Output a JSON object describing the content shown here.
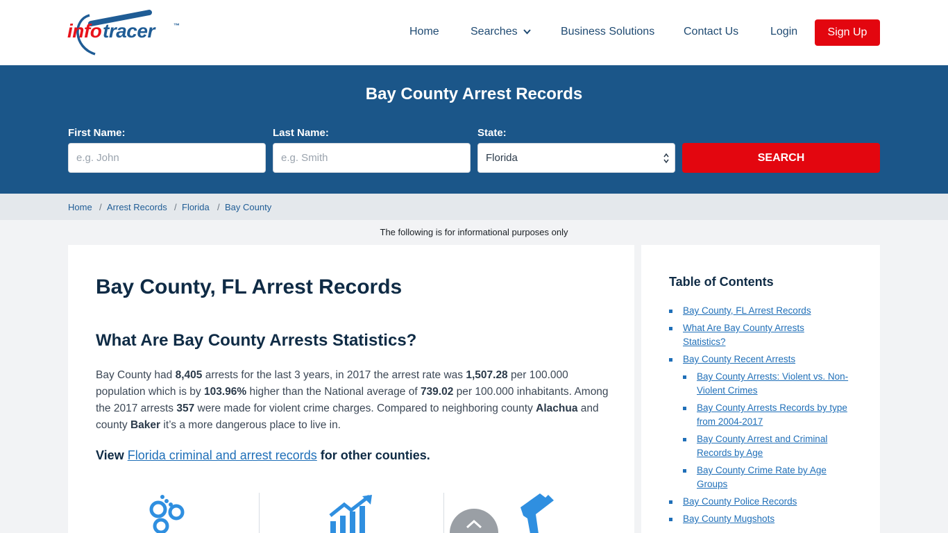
{
  "brand": {
    "part1": "info",
    "part2": "tracer",
    "tm": "™"
  },
  "nav": {
    "home": "Home",
    "searches": "Searches",
    "business": "Business Solutions",
    "contact": "Contact Us",
    "login": "Login",
    "signup": "Sign Up"
  },
  "hero": {
    "title": "Bay County Arrest Records",
    "first_label": "First Name:",
    "first_placeholder": "e.g. John",
    "last_label": "Last Name:",
    "last_placeholder": "e.g. Smith",
    "state_label": "State:",
    "state_value": "Florida",
    "search": "SEARCH"
  },
  "breadcrumb": [
    "Home",
    "Arrest Records",
    "Florida",
    "Bay County"
  ],
  "notice": "The following is for informational purposes only",
  "main": {
    "h1": "Bay County, FL Arrest Records",
    "h2": "What Are Bay County Arrests Statistics?",
    "p": [
      "Bay County had ",
      "8,405",
      " arrests for the last 3 years, in 2017 the arrest rate was ",
      "1,507.28",
      " per 100.000 population which is by ",
      "103.96%",
      " higher than the National average of ",
      "739.02",
      " per 100.000 inhabitants. Among the 2017 arrests ",
      "357",
      " were made for violent crime charges. Compared to neighboring county ",
      "Alachua",
      " and county ",
      "Baker",
      " it’s a more dangerous place to live in."
    ],
    "view_pre": "View ",
    "view_link": "Florida criminal and arrest records",
    "view_post": " for other counties."
  },
  "icons": [
    "handcuffs-icon",
    "growth-chart-icon",
    "handgun-icon",
    "chevron-up-icon"
  ],
  "toc": {
    "title": "Table of Contents",
    "items": [
      "Bay County, FL Arrest Records",
      "What Are Bay County Arrests Statistics?",
      "Bay County Recent Arrests",
      "Bay County Arrests: Violent vs. Non-Violent Crimes",
      "Bay County Arrests Records by type from 2004-2017",
      "Bay County Arrest and Criminal Records by Age",
      "Bay County Crime Rate by Age Groups",
      "Bay County Police Records",
      "Bay County Mugshots"
    ]
  },
  "colors": {
    "brand_blue": "#1b5689",
    "accent_red": "#e3060f",
    "link": "#1f6fb8",
    "icon_blue": "#2f8fe0"
  }
}
